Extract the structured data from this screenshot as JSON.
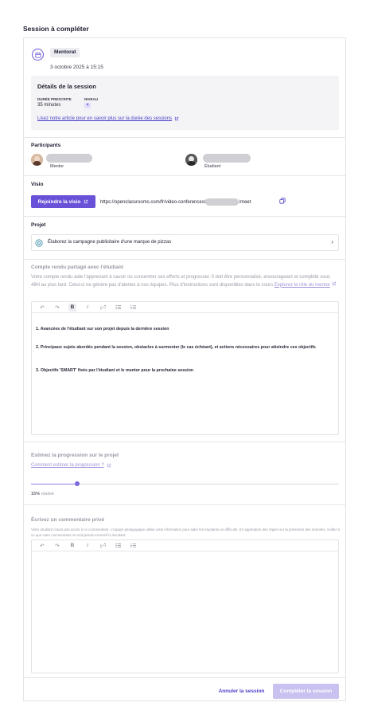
{
  "page": {
    "title": "Session à compléter"
  },
  "session": {
    "type_badge": "Mentorat",
    "datetime": "3 octobre 2025 à 15:15"
  },
  "details": {
    "title": "Détails de la session",
    "duration_label": "DURÉE PRESCRITE",
    "duration_value": "35 minutes",
    "level_label": "NIVEAU",
    "level_value": "4",
    "link_text": "Lisez notre article pour en savoir plus sur la durée des sessions"
  },
  "participants": {
    "title": "Participants",
    "mentor_role": "Mentor",
    "student_role": "Étudiant"
  },
  "visio": {
    "title": "Visio",
    "join_button": "Rejoindre la visio",
    "url_prefix": "https://openclassrooms.com/fr/video-conferences/",
    "url_suffix": "/meet"
  },
  "project": {
    "title": "Projet",
    "name": "Élaborez la campagne publicitaire d'une marque de pizzas"
  },
  "report": {
    "title": "Compte rendu partagé avec l'étudiant",
    "description": "Votre compte rendu aide l'apprenant à savoir où concentrer ses efforts et progresser. Il doit être personnalisé, encourageant et complété sous 48H au plus tard. Celui-ci ne génère pas d'alertes à nos équipes. Plus d'instructions sont disponibles dans le cours",
    "desc_link": "Explorez le rôle du mentor",
    "item1": "1. Avancées de l'étudiant sur son projet depuis la dernière session",
    "item2": "2. Principaux sujets abordés pendant la session, obstacles à surmonter (le cas échéant), et actions nécessaires pour atteindre ces objectifs",
    "item3": "3. Objectifs 'SMART' fixés par l'étudiant et le mentor pour la prochaine session"
  },
  "progress": {
    "title": "Estimez la progression sur le projet",
    "link_text": "Comment estimer la progression ?",
    "value_percent": 15,
    "value_label": "15%",
    "value_suffix": "réalisé"
  },
  "private_comment": {
    "title": "Écrivez un commentaire privé",
    "description": "Votre étudiant n'aura pas accès à ce commentaire. L'équipe pédagogique utilise cette information pour aider les étudiants en difficulté. En application des règles sur la protection des données, veillez à ce que votre commentaire ne soit jamais excessif ni insultant."
  },
  "toolbar": {
    "undo": "↶",
    "redo": "↷",
    "bold": "B",
    "italic": "I",
    "link": "🔗"
  },
  "actions": {
    "cancel": "Annuler la session",
    "complete": "Compléter la session"
  },
  "colors": {
    "accent": "#6a52d8",
    "link": "#4a3dc9",
    "disabled": "#c9c1f0"
  }
}
